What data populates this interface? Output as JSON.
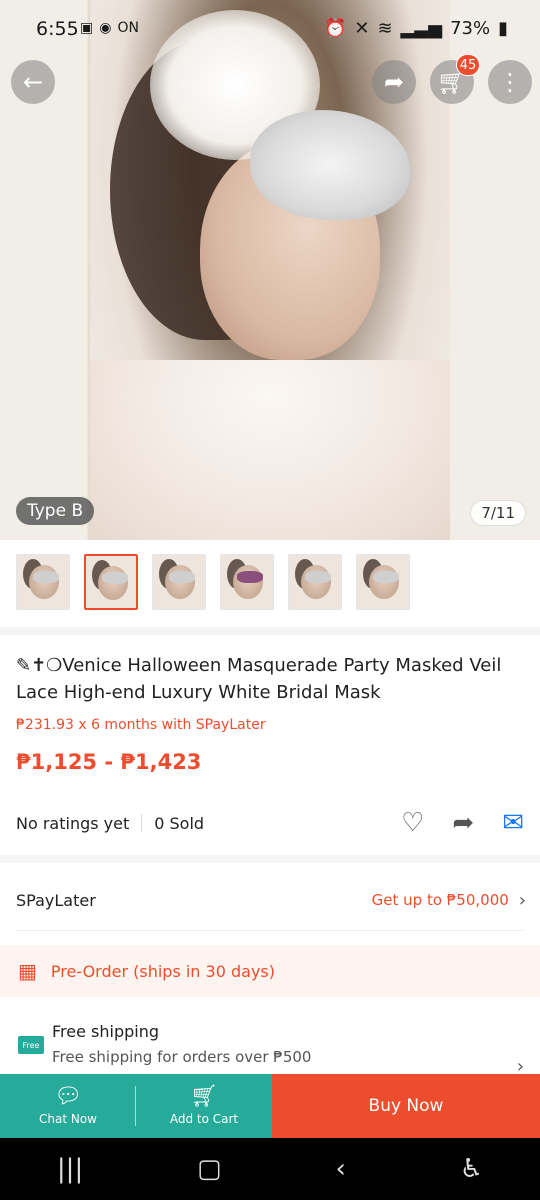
{
  "status": {
    "time": "6:55",
    "left_icons": [
      "image-icon",
      "messenger-icon",
      "on-icon"
    ],
    "battery": "73%"
  },
  "header": {
    "back_icon": "arrow-left-icon",
    "share_icon": "share-icon",
    "cart_icon": "cart-icon",
    "cart_badge": "45",
    "more_icon": "more-vertical-icon"
  },
  "gallery": {
    "variant_label": "Type B",
    "counter": "7/11",
    "thumbnail_count": 6,
    "active_thumbnail": 1
  },
  "product": {
    "title": "✎✝❍Venice Halloween Masquerade Party Masked Veil Lace High-end Luxury White Bridal Mask",
    "installment": "₱231.93 x 6 months with SPayLater",
    "price": "₱1,125 - ₱1,423",
    "ratings": "No ratings yet",
    "sold": "0 Sold"
  },
  "spaylater": {
    "label": "SPayLater",
    "offer": "Get up to ₱50,000"
  },
  "preorder": {
    "label": "Pre-Order (ships in 30 days)"
  },
  "shipping": {
    "badge": "Free",
    "title": "Free shipping",
    "subtitle": "Free shipping for orders over ₱500"
  },
  "actions": {
    "chat_label": "Chat Now",
    "cart_label": "Add to Cart",
    "buy_label": "Buy Now"
  },
  "colors": {
    "accent": "#ee4d2d",
    "teal": "#26aa99"
  }
}
